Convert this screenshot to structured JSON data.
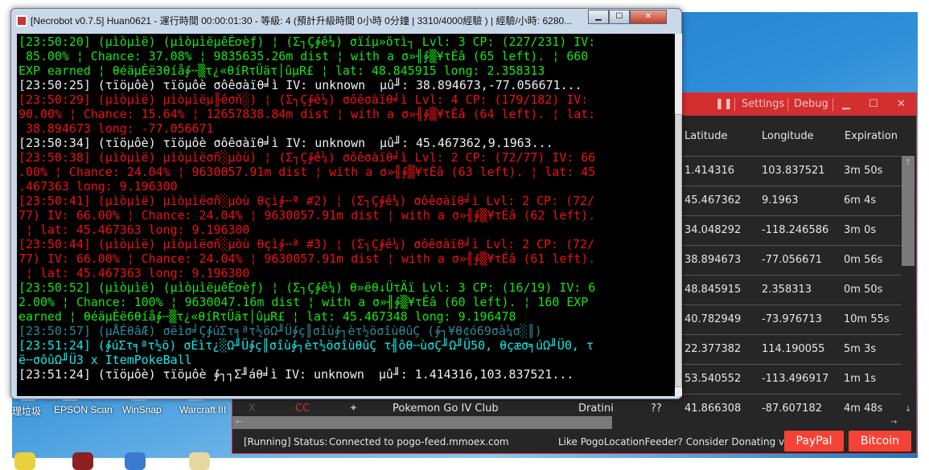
{
  "console": {
    "title": "[Necrobot v0.7.5] Huan0621 - 運行時間 00:00:01:30 - 等級: 4 (預計升級時間 0小時 0分鐘 | 3310/4000經驗 ) | 經驗/小時: 6280...",
    "lines": [
      {
        "color": "green",
        "text": "[23:50:20] (µìòµìë) (µìòµìëµêÉơèƒ) ¦ (Σ┐Ç∳ê¼) σïíµ»öτì┐ Lvl: 3 CP: (227/231) IV:"
      },
      {
        "color": "green",
        "text": " 85.00% ¦ Chance: 37.08% ¦ 9835635.26m dist ¦ with a σ»╢∳▒¥τÉâ (65 left). ¦ 660"
      },
      {
        "color": "green",
        "text": "EXP earned ¦ θéäµÈë3θíå∳╌▒τ¿«θíRτÜäτ│ûµR£ ¦ lat: 48.845915 long: 2.358313"
      },
      {
        "color": "white",
        "text": "[23:50:25] (τïöµôè) τïöµôè σôêσàïθ╛ì IV: unknown  µû╜: 38.894673,-77.056671..."
      },
      {
        "color": "red",
        "text": "[23:50:29] (µìòµìë) µìòµìëµ╟êσñ░) ¦ (Σ┐Ç∳ê¼) σôêσàïθ╛ì Lvl: 4 CP: (179/182) IV:"
      },
      {
        "color": "red",
        "text": "90.00% ¦ Chance: 15.64% ¦ 12657838.84m dist ¦ with a σ»╢∳▒¥τÉâ (64 left). ¦ lat:"
      },
      {
        "color": "red",
        "text": " 38.894673 long: -77.056671"
      },
      {
        "color": "white",
        "text": "[23:50:34] (τïöµôè) τïöµôè σôêσàïθ╛ì IV: unknown  µû╜: 45.467362,9.1963..."
      },
      {
        "color": "red",
        "text": "[23:50:38] (µìòµìë) µìòµìëσñ░µòù) ¦ (Σ┐Ç∳ê¼) σôêσàïθ╛ì Lvl: 2 CP: (72/77) IV: 66"
      },
      {
        "color": "red",
        "text": ".00% ¦ Chance: 24.04% ¦ 9630057.91m dist ¦ with a σ»╢∳▒¥τÉâ (63 left). ¦ lat: 45"
      },
      {
        "color": "red",
        "text": ".467363 long: 9.196300"
      },
      {
        "color": "red",
        "text": "[23:50:41] (µìòµìë) µìòµìëσñ░µòù θçì∳╌ª #2) ¦ (Σ┐Ç∳ê¼) σôêσàïθ╛ì Lvl: 2 CP: (72/"
      },
      {
        "color": "red",
        "text": "77) IV: 66.00% ¦ Chance: 24.04% ¦ 9630057.91m dist ¦ with a σ»╢∳▒¥τÉâ (62 left)."
      },
      {
        "color": "red",
        "text": " ¦ lat: 45.467363 long: 9.196300"
      },
      {
        "color": "red",
        "text": "[23:50:44] (µìòµìë) µìòµìëσñ░µòù θçì∳╌ª #3) ¦ (Σ┐Ç∳ê¼) σôêσàïθ╛ì Lvl: 2 CP: (72/"
      },
      {
        "color": "red",
        "text": "77) IV: 66.00% ¦ Chance: 24.04% ¦ 9630057.91m dist ¦ with a σ»╢∳▒¥τÉâ (61 left)."
      },
      {
        "color": "red",
        "text": " ¦ lat: 45.467363 long: 9.196300"
      },
      {
        "color": "green",
        "text": "[23:50:52] (µìòµìë) (µìòµìëµêÉơèƒ) ¦ (Σ┐Ç∳ê¼) θ»ëθ↓ÜτÄï Lvl: 3 CP: (16/19) IV: 6"
      },
      {
        "color": "green",
        "text": "2.00% ¦ Chance: 100% ¦ 9630047.16m dist ¦ with a σ»╢∳▒¥τÉâ (60 left). ¦ 160 EXP"
      },
      {
        "color": "green",
        "text": "earned ¦ θéäµÈë6θíå∳╌▒τ¿«θíRτÜäτ│ûµR£ ¦ lat: 45.467348 long: 9.196478"
      },
      {
        "color": "teal",
        "text": "[23:50:57] (µÅÉθâÆ) σëìσ╛Ç∳úΣτ╕ªτ½öΩ╜Ü∳ç║σîù∳┐èτ½öσîùθûÇ (∳┐¥θ¢ó69σà¼σ░║)"
      },
      {
        "color": "cyan",
        "text": "[23:51:24] (∳úΣτ╕ªτ½ö) σÉìτ¿░Ω╜Ü∳ç║σîù∳┐èτ½öσîùθûÇ τ╢ôθ╌ùσÇ╜Ω╜Ü50, θçæσ╕úΩ╜Ü0, τ"
      },
      {
        "color": "cyan",
        "text": "ë╌σôûΩ╜Ü3 x ItemPokeBall"
      },
      {
        "color": "white",
        "text": "[23:51:24] (τïöµôè) τïöµôè ∳┐┐Σ╜áθ╛ì IV: unknown  µû╜: 1.414316,103.837521..."
      }
    ]
  },
  "feeder": {
    "menu": {
      "pause": "❚❚",
      "settings": "Settings",
      "debug": "Debug",
      "minimize": "▁",
      "maximize": "☐",
      "close": "✕"
    },
    "columns": {
      "latitude": "Latitude",
      "longitude": "Longitude",
      "expiration": "Expiration"
    },
    "rows": [
      {
        "lat": "1.414316",
        "lng": "103.837521",
        "exp": "3m 50s"
      },
      {
        "lat": "45.467362",
        "lng": "9.1963",
        "exp": "6m 4s"
      },
      {
        "lat": "34.048292",
        "lng": "-118.246586",
        "exp": "3m 0s"
      },
      {
        "lat": "38.894673",
        "lng": "-77.056671",
        "exp": "0m 56s"
      },
      {
        "lat": "48.845915",
        "lng": "2.358313",
        "exp": "0m 50s"
      },
      {
        "lat": "40.782949",
        "lng": "-73.976713",
        "exp": "10m 55s"
      },
      {
        "lat": "22.377382",
        "lng": "114.190055",
        "exp": "5m 3s"
      },
      {
        "lat": "53.540552",
        "lng": "-113.496917",
        "exp": "1m 1s"
      },
      {
        "x": "X",
        "cc": "CC",
        "channel": "Pokemon Go IV Club",
        "pokemon": "Dratini",
        "iv": "??",
        "lat": "41.866308",
        "lng": "-87.607182",
        "exp": "4m 48s"
      }
    ],
    "status": {
      "running": "[Running]",
      "label": "Status:",
      "text": "Connected to pogo-feed.mmoex.com",
      "donate": "Like PogoLocationFeeder? Consider Donating via",
      "paypal": "PayPal",
      "bitcoin": "Bitcoin"
    },
    "accent": "#d32f2f"
  },
  "desktop": {
    "icons": [
      "理垃圾",
      "EPSON Scan",
      "WinSnap",
      "Warcraft III"
    ]
  }
}
